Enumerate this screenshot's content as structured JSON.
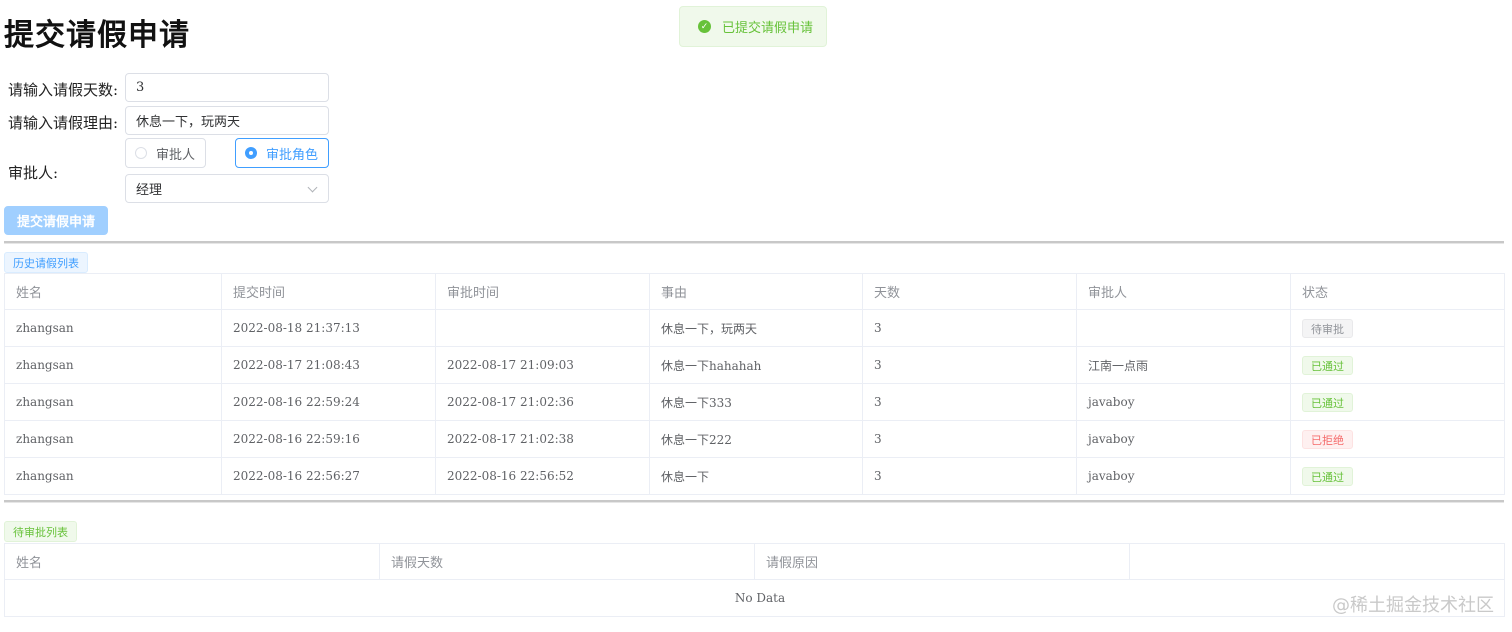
{
  "page_title": "提交请假申请",
  "toast": {
    "message": "已提交请假申请",
    "icon": "check-circle-icon"
  },
  "form": {
    "days_label": "请输入请假天数:",
    "days_value": "3",
    "reason_label": "请输入请假理由:",
    "reason_value": "休息一下，玩两天",
    "approver_label": "审批人:",
    "radio_approver": "审批人",
    "radio_role": "审批角色",
    "selected_radio": "审批角色",
    "role_select_value": "经理",
    "submit_label": "提交请假申请"
  },
  "history": {
    "tag": "历史请假列表",
    "columns": [
      "姓名",
      "提交时间",
      "审批时间",
      "事由",
      "天数",
      "审批人",
      "状态"
    ],
    "rows": [
      {
        "name": "zhangsan",
        "submit_time": "2022-08-18 21:37:13",
        "approve_time": "",
        "reason": "休息一下，玩两天",
        "days": "3",
        "approver": "",
        "status": "待审批",
        "status_type": "info"
      },
      {
        "name": "zhangsan",
        "submit_time": "2022-08-17 21:08:43",
        "approve_time": "2022-08-17 21:09:03",
        "reason": "休息一下hahahah",
        "days": "3",
        "approver": "江南一点雨",
        "status": "已通过",
        "status_type": "success"
      },
      {
        "name": "zhangsan",
        "submit_time": "2022-08-16 22:59:24",
        "approve_time": "2022-08-17 21:02:36",
        "reason": "休息一下333",
        "days": "3",
        "approver": "javaboy",
        "status": "已通过",
        "status_type": "success"
      },
      {
        "name": "zhangsan",
        "submit_time": "2022-08-16 22:59:16",
        "approve_time": "2022-08-17 21:02:38",
        "reason": "休息一下222",
        "days": "3",
        "approver": "javaboy",
        "status": "已拒绝",
        "status_type": "danger"
      },
      {
        "name": "zhangsan",
        "submit_time": "2022-08-16 22:56:27",
        "approve_time": "2022-08-16 22:56:52",
        "reason": "休息一下",
        "days": "3",
        "approver": "javaboy",
        "status": "已通过",
        "status_type": "success"
      }
    ]
  },
  "pending": {
    "tag": "待审批列表",
    "columns": [
      "姓名",
      "请假天数",
      "请假原因",
      ""
    ],
    "empty_text": "No Data"
  },
  "watermark": "@稀土掘金技术社区",
  "colors": {
    "primary": "#409eff",
    "success": "#67c23a",
    "danger": "#f56c6c",
    "info": "#909399"
  }
}
